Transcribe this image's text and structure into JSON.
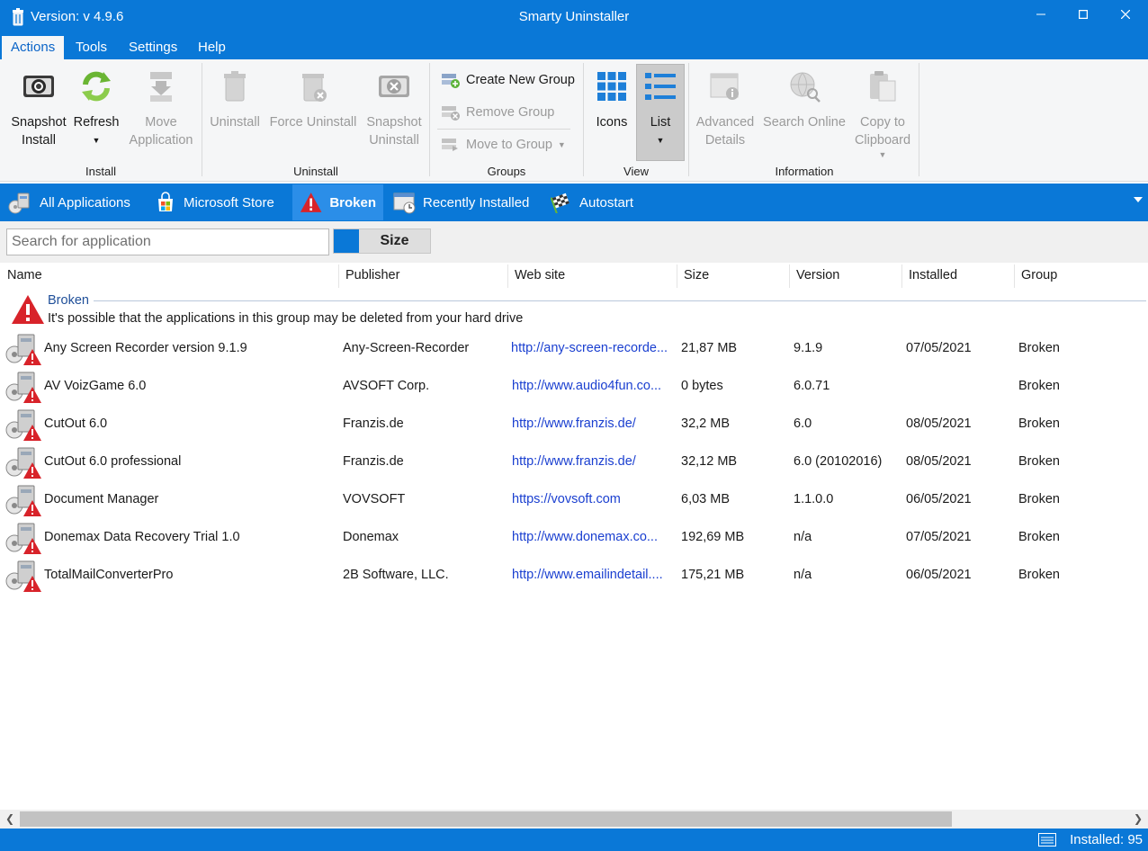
{
  "window": {
    "version": "Version: v 4.9.6",
    "title": "Smarty Uninstaller"
  },
  "menu": [
    "Actions",
    "Tools",
    "Settings",
    "Help"
  ],
  "ribbon": {
    "install": {
      "label": "Install",
      "snapshot_install": [
        "Snapshot",
        "Install"
      ],
      "refresh": "Refresh",
      "move_application": [
        "Move",
        "Application"
      ]
    },
    "uninstall": {
      "label": "Uninstall",
      "uninstall": "Uninstall",
      "force_uninstall": "Force Uninstall",
      "snapshot_uninstall": [
        "Snapshot",
        "Uninstall"
      ]
    },
    "groups": {
      "label": "Groups",
      "create": "Create New Group",
      "remove": "Remove Group",
      "move": "Move to Group"
    },
    "view": {
      "label": "View",
      "icons": "Icons",
      "list": "List"
    },
    "information": {
      "label": "Information",
      "advanced_details": [
        "Advanced",
        "Details"
      ],
      "search_online": "Search Online",
      "copy_clipboard": [
        "Copy to",
        "Clipboard"
      ]
    }
  },
  "tabs": [
    "All Applications",
    "Microsoft Store",
    "Broken",
    "Recently Installed",
    "Autostart"
  ],
  "search": {
    "placeholder": "Search for application",
    "sort_label": "Size"
  },
  "columns": [
    "Name",
    "Publisher",
    "Web site",
    "Size",
    "Version",
    "Installed",
    "Group"
  ],
  "group": {
    "title": "Broken",
    "description": "It's possible that the applications in this group may be deleted from your hard drive"
  },
  "rows": [
    [
      "Any Screen Recorder version 9.1.9",
      "Any-Screen-Recorder",
      "http://any-screen-recorde...",
      "21,87 MB",
      "9.1.9",
      "07/05/2021",
      "Broken"
    ],
    [
      "AV VoizGame 6.0",
      "AVSOFT Corp.",
      "http://www.audio4fun.co...",
      "0 bytes",
      "6.0.71",
      "",
      "Broken"
    ],
    [
      "CutOut 6.0",
      "Franzis.de",
      "http://www.franzis.de/",
      "32,2 MB",
      "6.0",
      "08/05/2021",
      "Broken"
    ],
    [
      "CutOut 6.0 professional",
      "Franzis.de",
      "http://www.franzis.de/",
      "32,12 MB",
      "6.0 (20102016)",
      "08/05/2021",
      "Broken"
    ],
    [
      "Document Manager",
      "VOVSOFT",
      "https://vovsoft.com",
      "6,03 MB",
      "1.1.0.0",
      "06/05/2021",
      "Broken"
    ],
    [
      "Donemax Data Recovery Trial 1.0",
      "Donemax",
      "http://www.donemax.co...",
      "192,69 MB",
      "n/a",
      "07/05/2021",
      "Broken"
    ],
    [
      "TotalMailConverterPro",
      "2B Software, LLC.",
      "http://www.emailindetail....",
      "175,21 MB",
      "n/a",
      "06/05/2021",
      "Broken"
    ]
  ],
  "status": {
    "installed": "Installed: 95"
  },
  "colors": {
    "accent": "#0a78d7",
    "link": "#1a3fd0",
    "warning": "#d8232a"
  }
}
